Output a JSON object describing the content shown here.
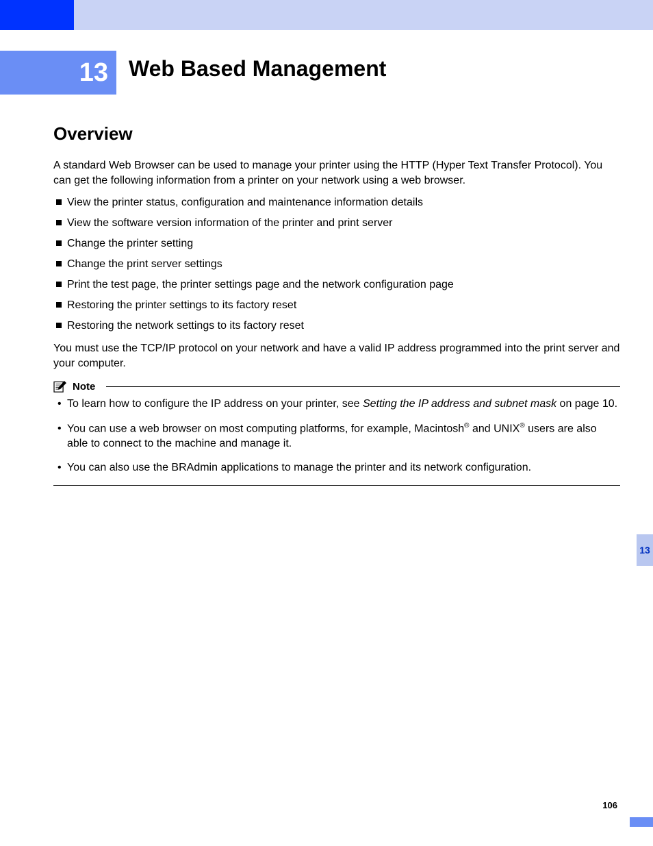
{
  "chapter": {
    "number": "13",
    "title": "Web Based Management"
  },
  "section": {
    "heading": "Overview"
  },
  "intro": "A standard Web Browser can be used to manage your printer using the HTTP (Hyper Text Transfer Protocol). You can get the following information from a printer on your network using a web browser.",
  "bullets": [
    "View the printer status, configuration and maintenance information details",
    "View the software version information of the printer and print server",
    "Change the printer setting",
    "Change the print server settings",
    "Print the test page, the printer settings page and the network configuration page",
    "Restoring the printer settings to its factory reset",
    "Restoring the network settings to its factory reset"
  ],
  "closing": "You must use the TCP/IP protocol on your network and have a valid IP address programmed into the print server and your computer.",
  "note": {
    "label": "Note",
    "item1_prefix": "To learn how to configure the IP address on your printer, see ",
    "item1_italic": "Setting the IP address and subnet mask",
    "item1_suffix": " on page 10.",
    "item2_prefix": " You can use a web browser on most computing platforms, for example, Macintosh",
    "item2_sup1": "®",
    "item2_mid": " and UNIX",
    "item2_sup2": "®",
    "item2_suffix": " users are also able to connect to the machine and manage it.",
    "item3": "You can also use the BRAdmin applications to manage the printer and its network configuration."
  },
  "sideTab": "13",
  "pageNumber": "106"
}
